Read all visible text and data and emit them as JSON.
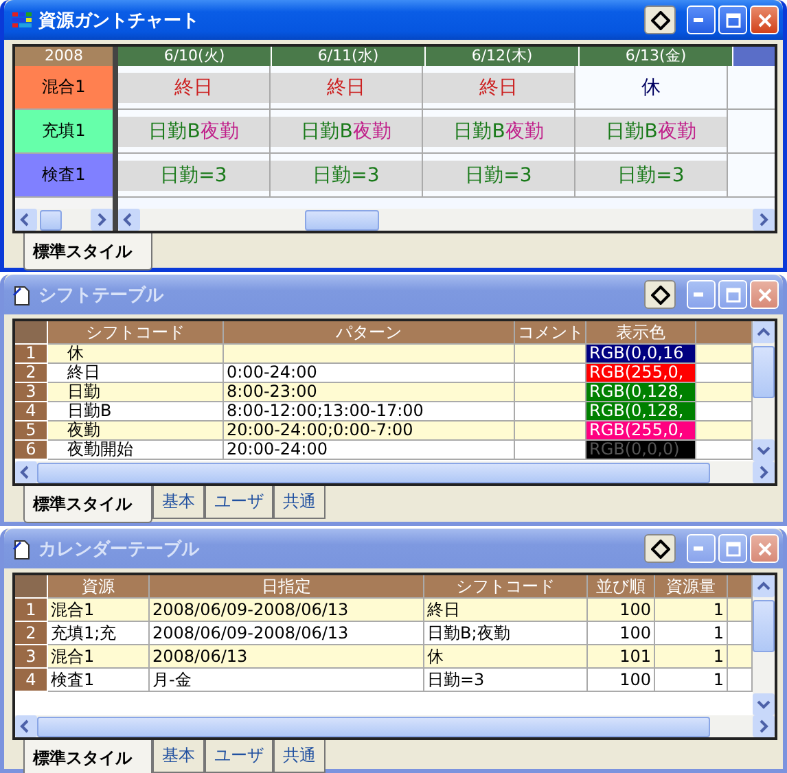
{
  "windows": [
    {
      "kind": "gantt",
      "title": "資源ガントチャート",
      "active": true,
      "corner": "2008",
      "dates": [
        "6/10(火)",
        "6/11(水)",
        "6/12(木)",
        "6/13(金)"
      ],
      "resources": [
        {
          "name": "混合1",
          "color": "#ff8050",
          "cells": [
            {
              "bar": true,
              "parts": [
                {
                  "text": "終日",
                  "color": "#cc2020"
                }
              ]
            },
            {
              "bar": true,
              "parts": [
                {
                  "text": "終日",
                  "color": "#cc2020"
                }
              ]
            },
            {
              "bar": true,
              "parts": [
                {
                  "text": "終日",
                  "color": "#cc2020"
                }
              ]
            },
            {
              "bar": false,
              "parts": [
                {
                  "text": "休",
                  "color": "#000060"
                }
              ]
            }
          ]
        },
        {
          "name": "充填1",
          "color": "#66ffaa",
          "cells": [
            {
              "bar": true,
              "parts": [
                {
                  "text": "日勤B",
                  "color": "#1a7a1a"
                },
                {
                  "text": "夜勤",
                  "color": "#c0208a"
                }
              ]
            },
            {
              "bar": true,
              "parts": [
                {
                  "text": "日勤B",
                  "color": "#1a7a1a"
                },
                {
                  "text": "夜勤",
                  "color": "#c0208a"
                }
              ]
            },
            {
              "bar": true,
              "parts": [
                {
                  "text": "日勤B",
                  "color": "#1a7a1a"
                },
                {
                  "text": "夜勤",
                  "color": "#c0208a"
                }
              ]
            },
            {
              "bar": true,
              "parts": [
                {
                  "text": "日勤B",
                  "color": "#1a7a1a"
                },
                {
                  "text": "夜勤",
                  "color": "#c0208a"
                }
              ]
            }
          ]
        },
        {
          "name": "検査1",
          "color": "#8080ff",
          "cells": [
            {
              "bar": true,
              "parts": [
                {
                  "text": "日勤=3",
                  "color": "#1a7a1a"
                }
              ]
            },
            {
              "bar": true,
              "parts": [
                {
                  "text": "日勤=3",
                  "color": "#1a7a1a"
                }
              ]
            },
            {
              "bar": true,
              "parts": [
                {
                  "text": "日勤=3",
                  "color": "#1a7a1a"
                }
              ]
            },
            {
              "bar": true,
              "parts": [
                {
                  "text": "日勤=3",
                  "color": "#1a7a1a"
                }
              ]
            }
          ]
        }
      ],
      "tabs": [
        {
          "label": "標準スタイル",
          "selected": true
        }
      ]
    },
    {
      "kind": "table",
      "title": "シフトテーブル",
      "active": false,
      "columns": [
        {
          "label": "シフトコード",
          "kind": "code"
        },
        {
          "label": "パターン",
          "kind": "text"
        },
        {
          "label": "コメント",
          "kind": "text"
        },
        {
          "label": "表示色",
          "kind": "color"
        }
      ],
      "rows": [
        {
          "number": "1",
          "cells": [
            "休",
            "",
            "",
            {
              "text": "RGB(0,0,16",
              "color": "#000080"
            }
          ]
        },
        {
          "number": "2",
          "cells": [
            "終日",
            "0:00-24:00",
            "",
            {
              "text": "RGB(255,0,",
              "color": "#ff0000"
            }
          ]
        },
        {
          "number": "3",
          "cells": [
            "日勤",
            "8:00-23:00",
            "",
            {
              "text": "RGB(0,128,",
              "color": "#008000"
            }
          ]
        },
        {
          "number": "4",
          "cells": [
            "日勤B",
            "8:00-12:00;13:00-17:00",
            "",
            {
              "text": "RGB(0,128,",
              "color": "#008000"
            }
          ]
        },
        {
          "number": "5",
          "cells": [
            "夜勤",
            "20:00-24:00;0:00-7:00",
            "",
            {
              "text": "RGB(255,0,",
              "color": "#ff0080"
            }
          ]
        },
        {
          "number": "6",
          "cells": [
            "夜勤開始",
            "20:00-24:00",
            "",
            {
              "text": "RGB(0,0,0)",
              "color": "#000000"
            }
          ]
        }
      ],
      "tabs": [
        {
          "label": "標準スタイル",
          "selected": true
        },
        {
          "label": "基本",
          "selected": false
        },
        {
          "label": "ユーザ",
          "selected": false
        },
        {
          "label": "共通",
          "selected": false
        }
      ]
    },
    {
      "kind": "table",
      "title": "カレンダーテーブル",
      "active": false,
      "columns": [
        {
          "label": "資源",
          "kind": "text"
        },
        {
          "label": "日指定",
          "kind": "text"
        },
        {
          "label": "シフトコード",
          "kind": "text"
        },
        {
          "label": "並び順",
          "kind": "number"
        },
        {
          "label": "資源量",
          "kind": "number"
        }
      ],
      "rows": [
        {
          "number": "1",
          "cells": [
            "混合1",
            "2008/06/09-2008/06/13",
            "終日",
            "100",
            "1"
          ]
        },
        {
          "number": "2",
          "cells": [
            "充填1;充",
            "2008/06/09-2008/06/13",
            "日勤B;夜勤",
            "100",
            "1"
          ]
        },
        {
          "number": "3",
          "cells": [
            "混合1",
            "2008/06/13",
            "休",
            "101",
            "1"
          ]
        },
        {
          "number": "4",
          "cells": [
            "検査1",
            "月-金",
            "日勤=3",
            "100",
            "1"
          ]
        }
      ],
      "tabs": [
        {
          "label": "標準スタイル",
          "selected": true
        },
        {
          "label": "基本",
          "selected": false
        },
        {
          "label": "ユーザ",
          "selected": false
        },
        {
          "label": "共通",
          "selected": false
        }
      ]
    }
  ]
}
